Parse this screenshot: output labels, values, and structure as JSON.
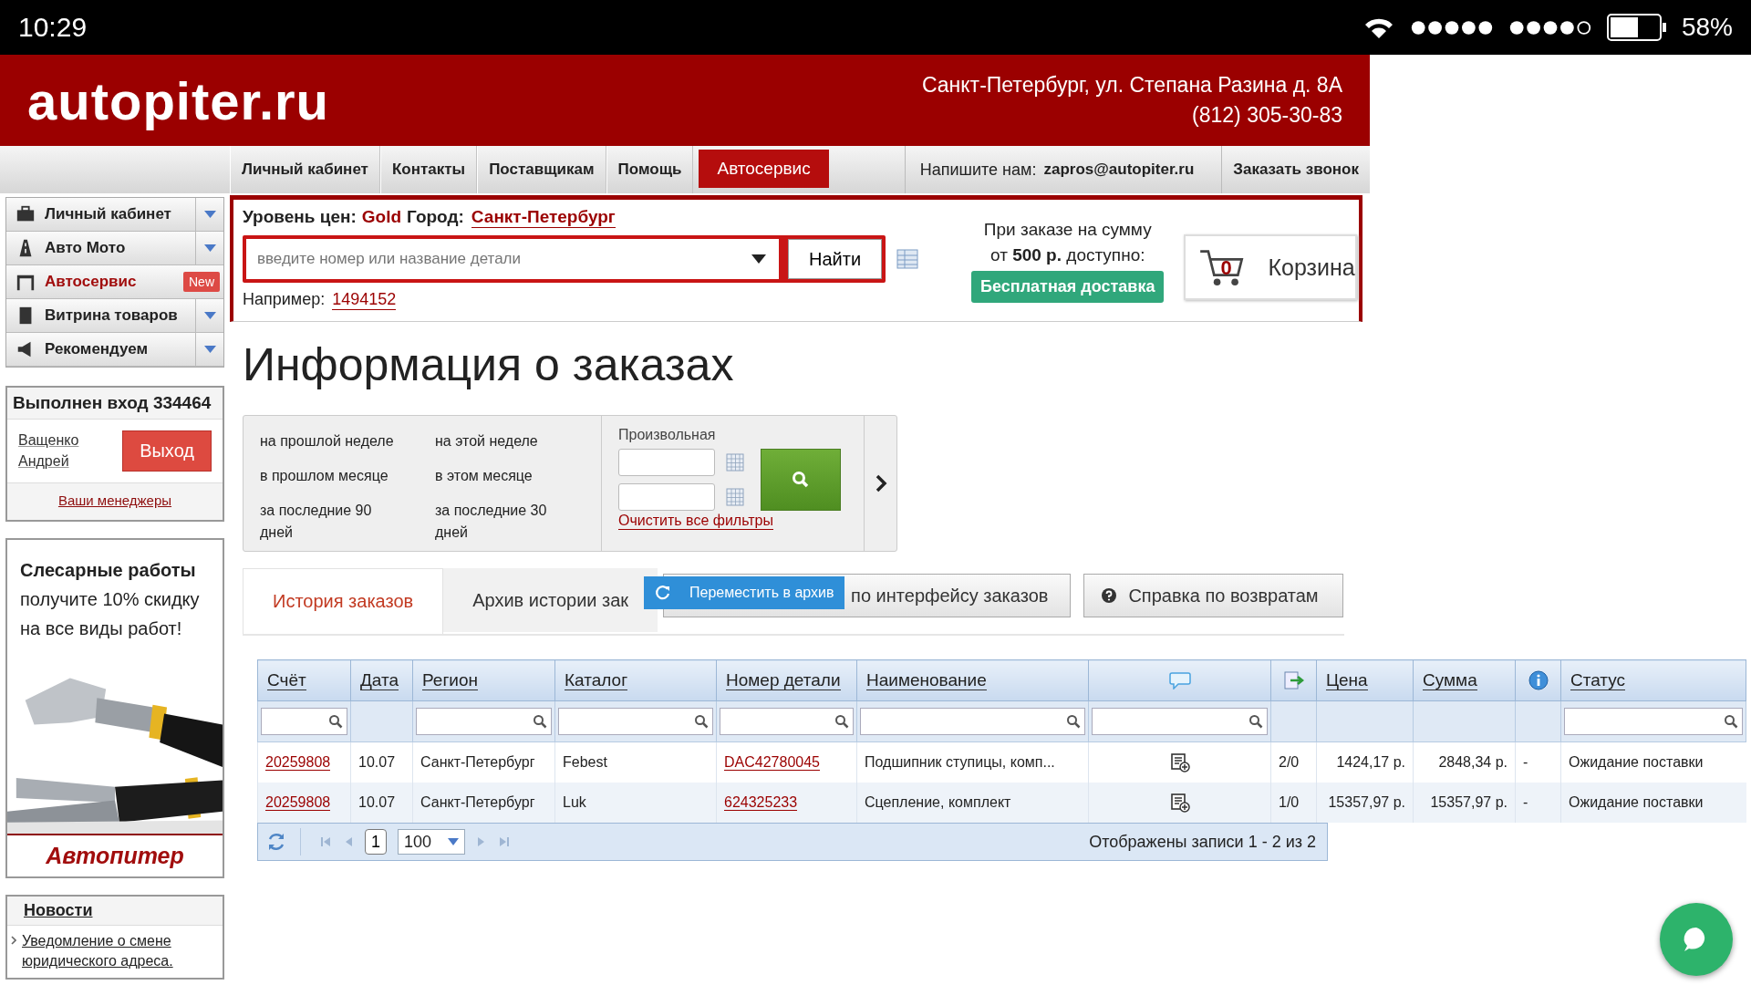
{
  "status_bar": {
    "time": "10:29",
    "battery": "58%"
  },
  "header": {
    "logo": "autopiter.ru",
    "address": "Санкт-Петербург, ул. Степана Разина д. 8А",
    "phone": "(812) 305-30-83"
  },
  "nav": {
    "items": [
      {
        "label": "Личный кабинет",
        "selected": false
      },
      {
        "label": "Контакты",
        "selected": false
      },
      {
        "label": "Поставщикам",
        "selected": false
      },
      {
        "label": "Помощь",
        "selected": false
      },
      {
        "label": "Автосервис",
        "selected": true
      }
    ],
    "contact_label": "Напишите нам:",
    "contact_email": "zapros@autopiter.ru",
    "callback": "Заказать звонок"
  },
  "sidebar": {
    "menu": [
      {
        "label": "Личный кабинет",
        "kind": "case",
        "selected": false
      },
      {
        "label": "Авто Мото",
        "kind": "road",
        "selected": false
      },
      {
        "label": "Автосервис",
        "kind": "lift",
        "selected": true,
        "badge": "New"
      },
      {
        "label": "Витрина товаров",
        "kind": "book",
        "selected": false
      },
      {
        "label": "Рекомендуем",
        "kind": "horn",
        "selected": false
      }
    ],
    "login": {
      "title": "Выполнен вход 334464",
      "user": "Ващенко Андрей",
      "logout": "Выход",
      "managers": "Ваши менеджеры"
    },
    "ad": {
      "title": "Слесарные работы",
      "text": "получите 10% скидку на все виды работ!",
      "brand": "Автопитер"
    },
    "news": {
      "title": "Новости",
      "items": [
        "Уведомление о смене юридического адреса."
      ]
    }
  },
  "search": {
    "price_label": "Уровень цен:",
    "price_level": "Gold",
    "city_label": "Город:",
    "city": "Санкт-Петербург",
    "placeholder": "введите номер или название детали",
    "button": "Найти",
    "example_label": "Например:",
    "example": "1494152"
  },
  "delivery": {
    "line1": "При заказе на сумму",
    "line2": "от **500 р.** доступно:",
    "button": "Бесплатная доставка"
  },
  "cart": {
    "count": "0",
    "label": "Корзина"
  },
  "title": "Информация о заказах",
  "filters": {
    "periods": [
      "на прошлой неделе",
      "на этой неделе",
      "в прошлом месяце",
      "в этом месяце",
      "за последние 90 дней",
      "за последние 30 дней"
    ],
    "custom_label": "Произвольная",
    "clear": "Очистить все фильтры"
  },
  "tabs": [
    {
      "label": "История заказов",
      "selected": true
    },
    {
      "label": "Архив истории зак",
      "selected": false
    }
  ],
  "tooltip": "Переместить в архив",
  "buttons": [
    {
      "label": "по интерфейсу заказов",
      "kind": "plain"
    },
    {
      "label": "Справка по возвратам",
      "kind": "help"
    }
  ],
  "table": {
    "columns": [
      {
        "kind": "text",
        "label": "Счёт",
        "filterable": true
      },
      {
        "kind": "text",
        "label": "Дата",
        "filterable": false
      },
      {
        "kind": "text",
        "label": "Регион",
        "filterable": true
      },
      {
        "kind": "text",
        "label": "Каталог",
        "filterable": true
      },
      {
        "kind": "text",
        "label": "Номер детали",
        "filterable": true
      },
      {
        "kind": "text",
        "label": "Наименование",
        "filterable": true
      },
      {
        "kind": "comment",
        "filterable": true
      },
      {
        "kind": "export",
        "filterable": false
      },
      {
        "kind": "text",
        "label": "Цена",
        "filterable": false
      },
      {
        "kind": "text",
        "label": "Сумма",
        "filterable": false
      },
      {
        "kind": "info",
        "filterable": false
      },
      {
        "kind": "text",
        "label": "Статус",
        "filterable": true
      }
    ],
    "rows": [
      {
        "cells": [
          {
            "text": "20259808",
            "link": true
          },
          {
            "text": "10.07",
            "link": false
          },
          {
            "text": "Санкт-Петербург",
            "link": false
          },
          {
            "text": "Febest",
            "link": false
          },
          {
            "text": "DAC42780045",
            "link": true
          },
          {
            "text": "Подшипник ступицы, комп...",
            "link": false
          },
          {
            "kind": "note"
          },
          {
            "text": "2/0",
            "link": false
          },
          {
            "text": "1424,17 р.",
            "link": false
          },
          {
            "text": "2848,34 р.",
            "link": false
          },
          {
            "text": "-",
            "link": false
          },
          {
            "text": "Ожидание поставки",
            "link": false
          }
        ]
      },
      {
        "cells": [
          {
            "text": "20259808",
            "link": true
          },
          {
            "text": "10.07",
            "link": false
          },
          {
            "text": "Санкт-Петербург",
            "link": false
          },
          {
            "text": "Luk",
            "link": false
          },
          {
            "text": "624325233",
            "link": true
          },
          {
            "text": "Сцепление, комплект",
            "link": false
          },
          {
            "kind": "note"
          },
          {
            "text": "1/0",
            "link": false
          },
          {
            "text": "15357,97 р.",
            "link": false
          },
          {
            "text": "15357,97 р.",
            "link": false
          },
          {
            "text": "-",
            "link": false
          },
          {
            "text": "Ожидание поставки",
            "link": false
          }
        ]
      }
    ],
    "footer": {
      "page": "1",
      "page_size": "100",
      "summary": "Отображены записи 1 - 2 из 2"
    }
  }
}
